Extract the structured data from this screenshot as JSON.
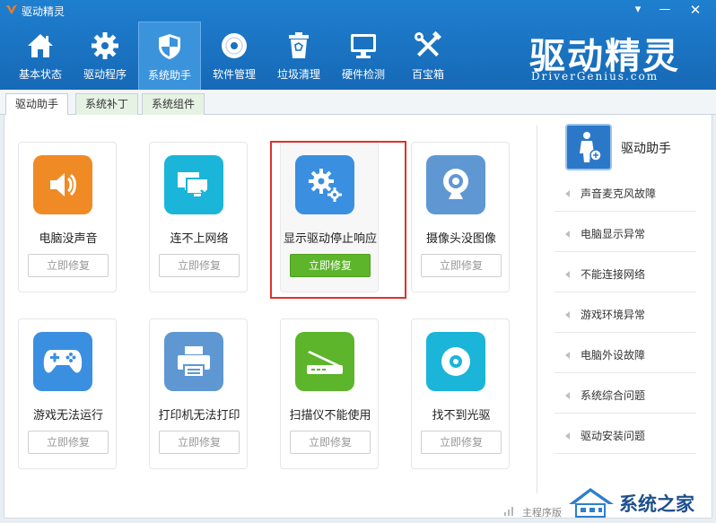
{
  "app": {
    "title": "驱动精灵",
    "window_controls": {
      "menu": "▾",
      "minimize": "—",
      "close": "✕"
    }
  },
  "toolbar": {
    "items": [
      {
        "label": "基本状态",
        "icon": "house-icon"
      },
      {
        "label": "驱动程序",
        "icon": "gear-icon"
      },
      {
        "label": "系统助手",
        "icon": "shield-icon",
        "active": true
      },
      {
        "label": "软件管理",
        "icon": "disc-icon"
      },
      {
        "label": "垃圾清理",
        "icon": "trash-icon"
      },
      {
        "label": "硬件检测",
        "icon": "monitor-icon"
      },
      {
        "label": "百宝箱",
        "icon": "tools-icon"
      }
    ]
  },
  "brand": {
    "cn": "驱动精灵",
    "en": "DriverGenius.com"
  },
  "subtabs": [
    {
      "label": "驱动助手",
      "active": true
    },
    {
      "label": "系统补丁"
    },
    {
      "label": "系统组件"
    }
  ],
  "cards": [
    {
      "label": "电脑没声音",
      "button": "立即修复",
      "icon": "speaker-icon",
      "color": "#f08a24"
    },
    {
      "label": "连不上网络",
      "button": "立即修复",
      "icon": "network-disconnected-icon",
      "color": "#1ab5d9"
    },
    {
      "label": "显示驱动停止响应",
      "button": "立即修复",
      "icon": "gears-icon",
      "color": "#3a8fe0",
      "selected": true
    },
    {
      "label": "摄像头没图像",
      "button": "立即修复",
      "icon": "webcam-icon",
      "color": "#5f97d3"
    },
    {
      "label": "游戏无法运行",
      "button": "立即修复",
      "icon": "gamepad-icon",
      "color": "#3a8fe0"
    },
    {
      "label": "打印机无法打印",
      "button": "立即修复",
      "icon": "printer-icon",
      "color": "#5f97d3"
    },
    {
      "label": "扫描仪不能使用",
      "button": "立即修复",
      "icon": "scanner-icon",
      "color": "#5cb52a"
    },
    {
      "label": "找不到光驱",
      "button": "立即修复",
      "icon": "optical-disc-icon",
      "color": "#1ab5d9"
    }
  ],
  "sidebar": {
    "title": "驱动助手",
    "items": [
      "声音麦克风故障",
      "电脑显示异常",
      "不能连接网络",
      "游戏环境异常",
      "电脑外设故障",
      "系统综合问题",
      "驱动安装问题"
    ]
  },
  "footer": {
    "version": "主程序版"
  },
  "watermark": {
    "text": "系统之家"
  },
  "colors": {
    "accent_blue": "#1669b6",
    "button_green": "#5cb52a",
    "highlight_red": "#e0312e"
  }
}
